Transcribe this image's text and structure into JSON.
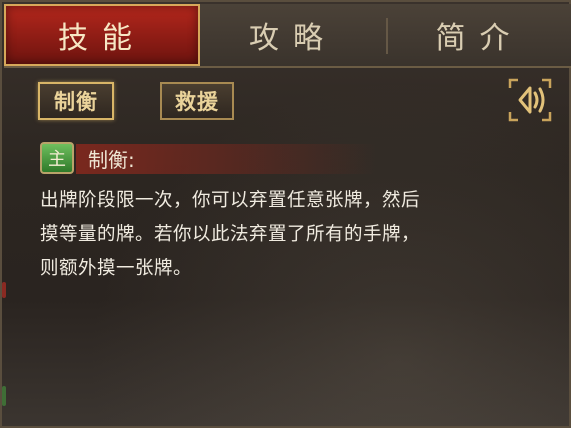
{
  "tabs": [
    {
      "label": "技能",
      "active": true
    },
    {
      "label": "攻略",
      "active": false
    },
    {
      "label": "简介",
      "active": false
    }
  ],
  "skill_buttons": [
    {
      "label": "制衡",
      "selected": true
    },
    {
      "label": "救援",
      "selected": false
    }
  ],
  "audio_icon": "speaker-icon",
  "skill": {
    "badge": "主",
    "name": "制衡:",
    "description": [
      "出牌阶段限一次，你可以弃置任意张牌，然后",
      "摸等量的牌。若你以此法弃置了所有的手牌，",
      "则额外摸一张牌。"
    ]
  },
  "colors": {
    "active_tab": "#a62219",
    "text_gold": "#ead39a",
    "badge_green": "#4f9d43"
  }
}
